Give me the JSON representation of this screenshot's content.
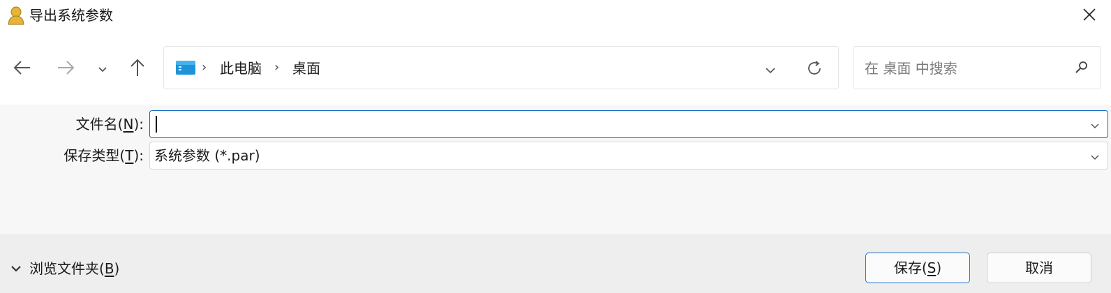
{
  "window": {
    "title": "导出系统参数",
    "app_icon": "user-icon",
    "close_icon": "close-icon"
  },
  "nav": {
    "back_icon": "arrow-left-icon",
    "forward_icon": "arrow-right-icon",
    "recent_icon": "chevron-down-icon",
    "up_icon": "arrow-up-icon",
    "breadcrumb": [
      "此电脑",
      "桌面"
    ],
    "address_dropdown_icon": "chevron-down-icon",
    "refresh_icon": "refresh-icon",
    "search_placeholder": "在 桌面 中搜索",
    "search_icon": "search-icon"
  },
  "form": {
    "filename_label_prefix": "文件名(",
    "filename_label_key": "N",
    "filename_label_suffix": "):",
    "filename_value": "",
    "filetype_label_prefix": "保存类型(",
    "filetype_label_key": "T",
    "filetype_label_suffix": "):",
    "filetype_value": "系统参数 (*.par)"
  },
  "footer": {
    "browse_prefix": "浏览文件夹(",
    "browse_key": "B",
    "browse_suffix": ")",
    "save_prefix": "保存(",
    "save_key": "S",
    "save_suffix": ")",
    "cancel_label": "取消"
  },
  "colors": {
    "accent": "#0f6cbd",
    "form_bg": "#f7f7f7",
    "footer_bg": "#eeeeee"
  }
}
